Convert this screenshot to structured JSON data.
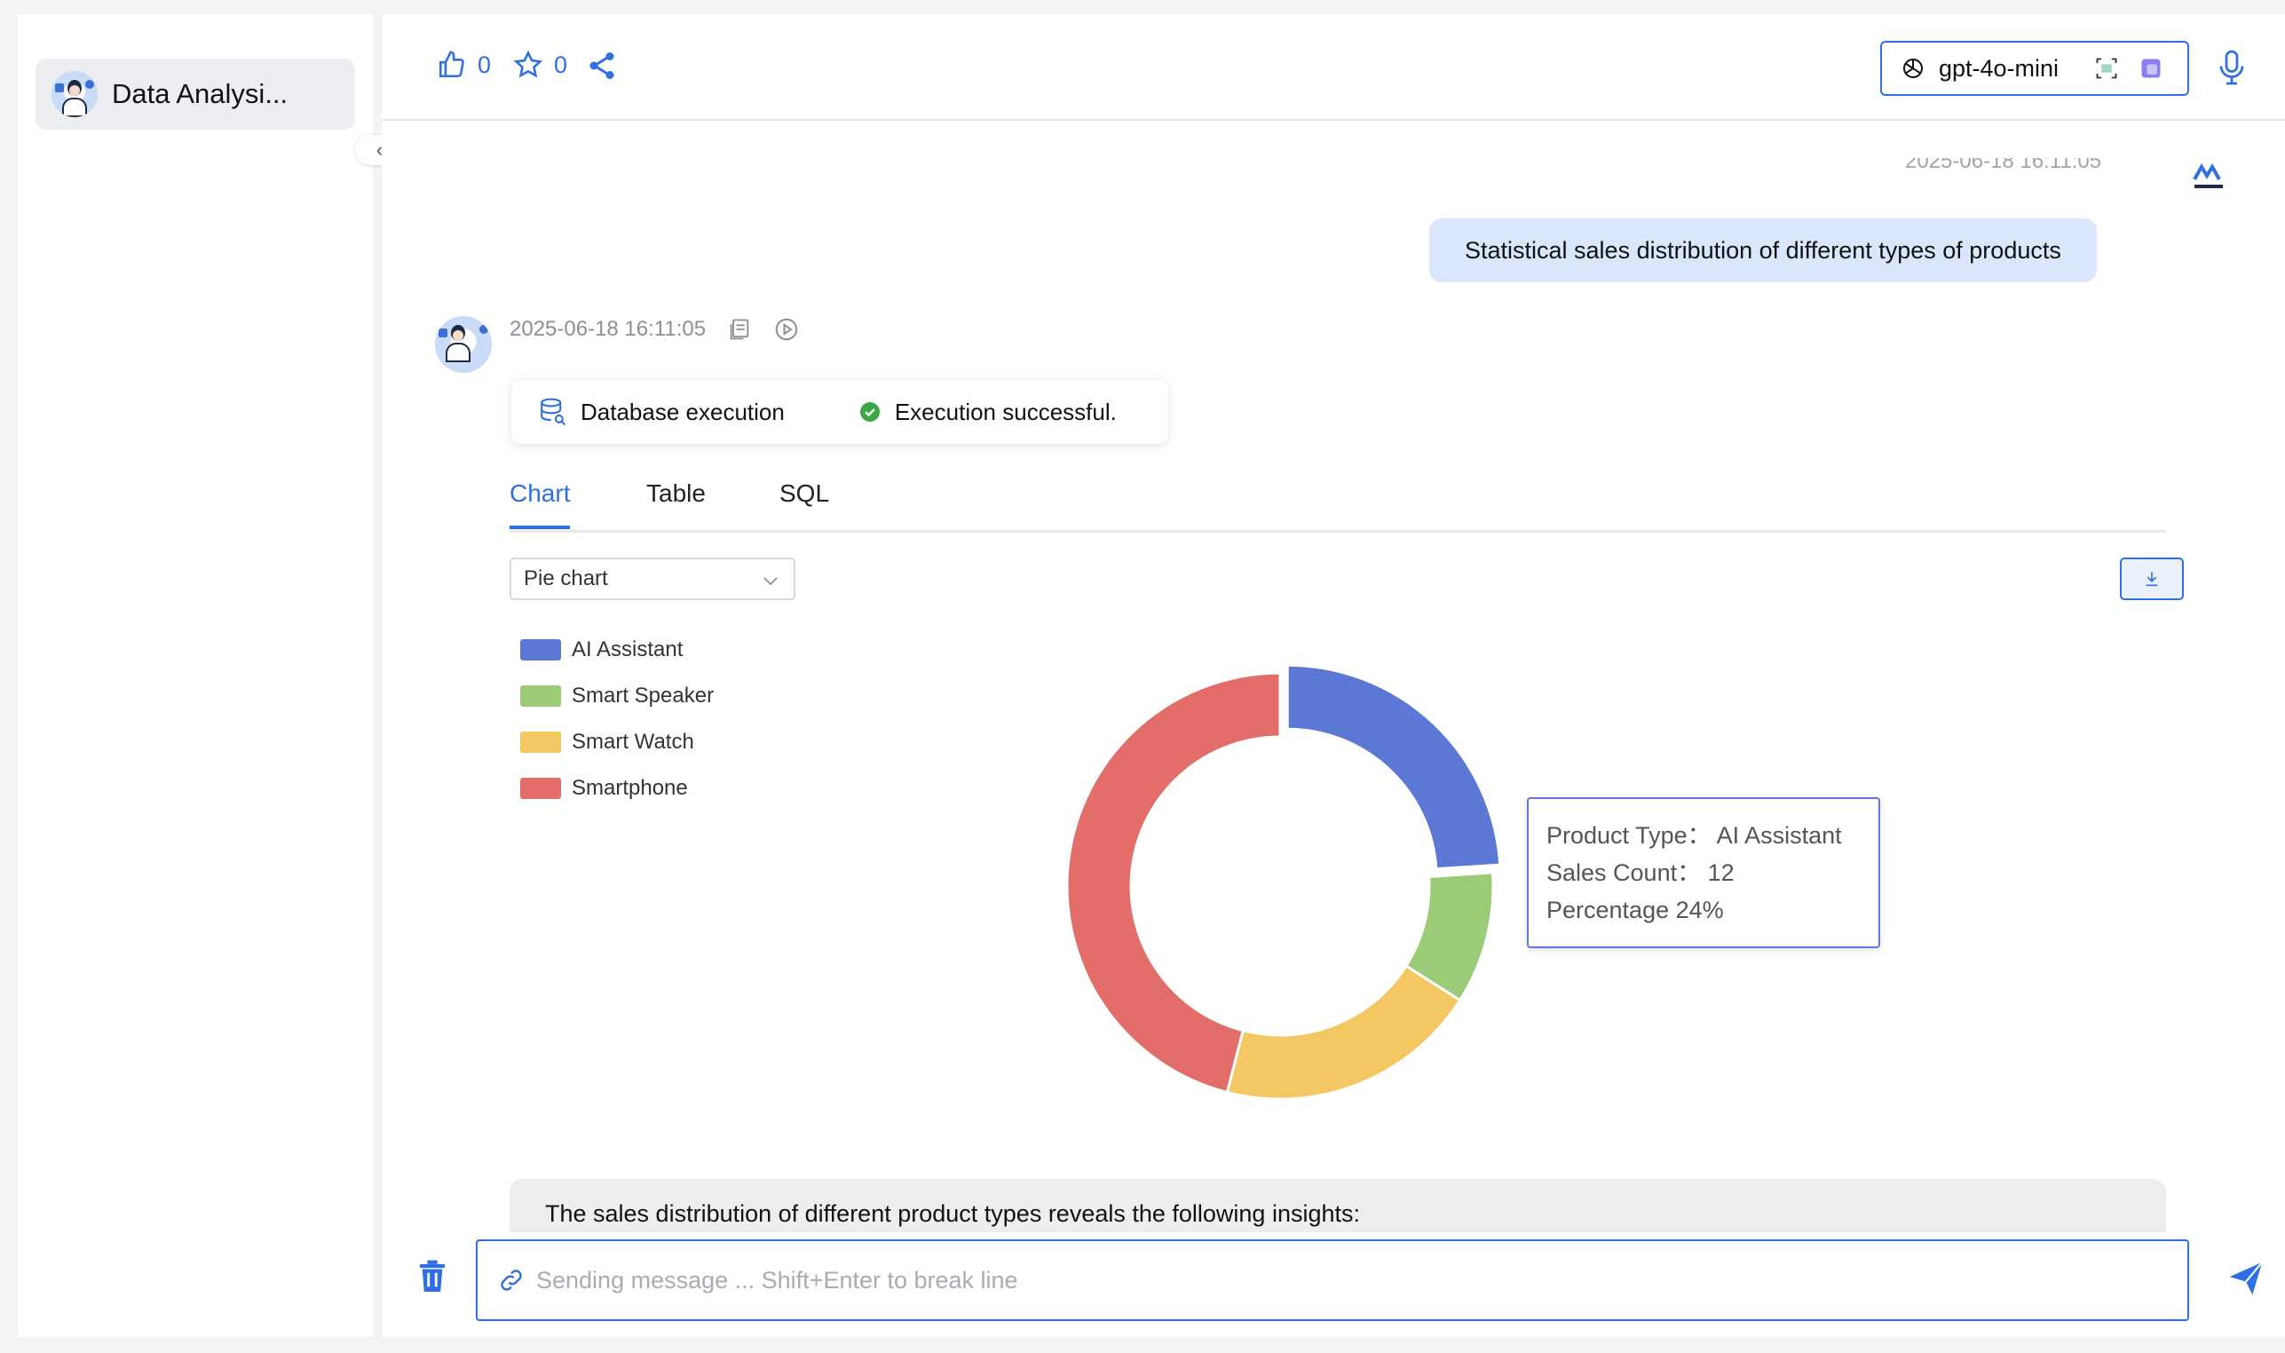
{
  "sidebar": {
    "items": [
      {
        "label": "Data Analysi..."
      }
    ]
  },
  "toolbar": {
    "like_count": "0",
    "star_count": "0",
    "model": "gpt-4o-mini"
  },
  "chat": {
    "user_timestamp": "2025-06-18 16:11:05",
    "user_message": "Statistical sales distribution of different types of products",
    "bot_timestamp": "2025-06-18 16:11:05",
    "execution": {
      "step_label": "Database execution",
      "status_label": "Execution successful."
    },
    "tabs": [
      {
        "label": "Chart",
        "active": true
      },
      {
        "label": "Table",
        "active": false
      },
      {
        "label": "SQL",
        "active": false
      }
    ],
    "chart_type_select": "Pie chart",
    "tooltip": {
      "line1": "Product Type： AI Assistant",
      "line2": "Sales Count： 12",
      "line3": "Percentage 24%"
    },
    "insight_text": "The sales distribution of different product types reveals the following insights:"
  },
  "input": {
    "placeholder": "Sending message ... Shift+Enter to break line",
    "value": ""
  },
  "colors": {
    "accent": "#2f6fe4",
    "user_bubble": "#d9e6fb"
  },
  "chart_data": {
    "type": "pie",
    "donut": true,
    "categories": [
      "AI Assistant",
      "Smart Speaker",
      "Smart Watch",
      "Smartphone"
    ],
    "values": [
      12,
      5,
      10,
      23
    ],
    "colors": [
      "#5b78d4",
      "#9ccb78",
      "#f3c862",
      "#e36e69"
    ],
    "legend_position": "top-left"
  }
}
